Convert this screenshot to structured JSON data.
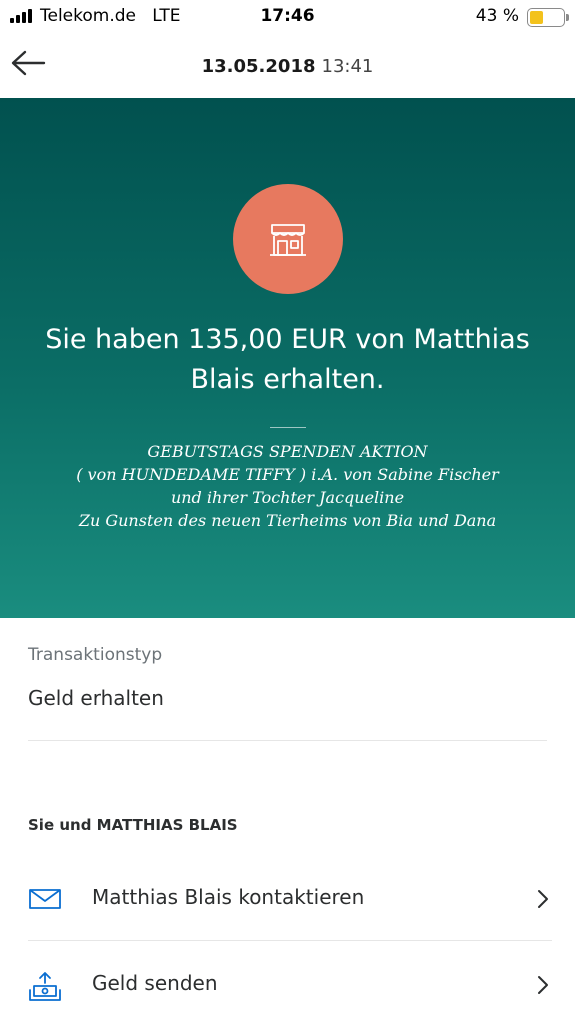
{
  "status_bar": {
    "carrier": "Telekom.de",
    "network": "LTE",
    "time": "17:46",
    "battery_percent": "43 %",
    "battery_level": 0.43
  },
  "header": {
    "date": "13.05.2018",
    "time": "13:41",
    "back_icon": "arrow-left-icon"
  },
  "hero": {
    "icon": "storefront-icon",
    "accent_color": "#e7795f",
    "title": "Sie haben 135,00 EUR von Matthias Blais erhalten.",
    "note_lines": [
      "GEBUTSTAGS SPENDEN AKTION",
      "( von HUNDEDAME TIFFY ) i.A. von Sabine Fischer",
      "und ihrer Tochter Jacqueline",
      "Zu Gunsten des neuen Tierheims von Bia und Dana"
    ]
  },
  "details": {
    "transaction_type_label": "Transaktionstyp",
    "transaction_type_value": "Geld erhalten"
  },
  "contact": {
    "heading": "Sie und MATTHIAS BLAIS",
    "actions": [
      {
        "label": "Matthias Blais kontaktieren",
        "icon": "envelope-icon"
      },
      {
        "label": "Geld senden",
        "icon": "send-money-icon"
      }
    ]
  }
}
